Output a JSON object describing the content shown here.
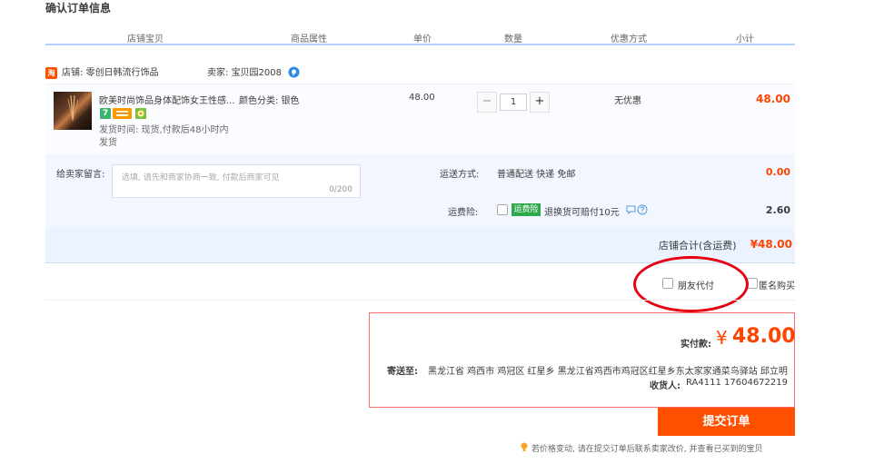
{
  "page_title": "确认订单信息",
  "columns": [
    "店铺宝贝",
    "商品属性",
    "单价",
    "数量",
    "优惠方式",
    "小计"
  ],
  "shop": {
    "logo_char": "淘",
    "label": "店铺:",
    "name": "零创日韩流行饰品",
    "seller_label": "卖家:",
    "seller_name": "宝贝园2008"
  },
  "item": {
    "title": "欧美时尚饰品身体配饰女王性感...",
    "attribute": "颜色分类: 银色",
    "tag7": "7",
    "ship_line1": "发货时间: 现货,付款后48小时内",
    "ship_line2": "发货",
    "unit_price": "48.00",
    "quantity": "1",
    "minus": "−",
    "plus": "+",
    "discount": "无优惠",
    "subtotal": "48.00"
  },
  "memo": {
    "label": "给卖家留言:",
    "placeholder": "选填, 请先和商家协商一致, 付款后商家可见",
    "counter": "0/200"
  },
  "shipping": {
    "label": "运送方式:",
    "value": "普通配送 快递 免邮",
    "price": "0.00"
  },
  "insurance": {
    "label": "运费险:",
    "tag": "运费险",
    "text": "退换货可赔付10元",
    "price": "2.60"
  },
  "shop_total": {
    "label": "店铺合计(含运费)",
    "value": "¥48.00"
  },
  "options": {
    "friend_pay": "朋友代付",
    "anonymous": "匿名购买"
  },
  "payment": {
    "label": "实付款:",
    "currency": "¥",
    "amount": "48.00",
    "address_label": "寄送至:",
    "address": "黑龙江省 鸡西市 鸡冠区 红星乡 黑龙江省鸡西市鸡冠区红星乡东太家家通菜鸟驿站 邱立明",
    "receiver_label": "收货人:",
    "receiver": "RA4111 17604672219"
  },
  "submit_label": "提交订单",
  "notice": "若价格变动, 请在提交订单后联系卖家改价, 并查看已买到的宝贝",
  "colors": {
    "accent": "#ff5000",
    "price": "#ff4400",
    "highlight_circle": "#e60012",
    "header_underline": "#b2d1ff"
  }
}
